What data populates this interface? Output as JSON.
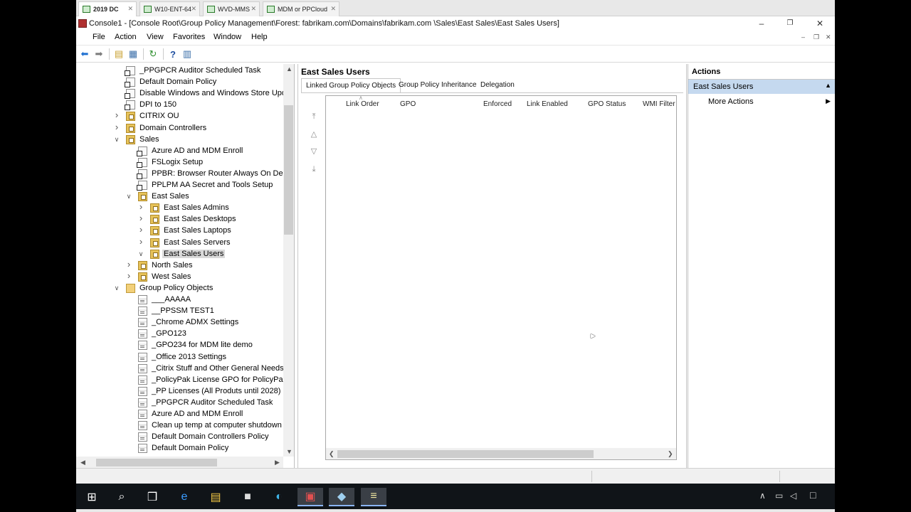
{
  "vm_tabs": [
    {
      "label": "2019 DC",
      "active": true
    },
    {
      "label": "W10-ENT-64",
      "active": false
    },
    {
      "label": "WVD-MMS",
      "active": false
    },
    {
      "label": "MDM or PPCloud",
      "active": false
    }
  ],
  "window": {
    "title": "Console1 - [Console Root\\Group Policy Management\\Forest: fabrikam.com\\Domains\\fabrikam.com \\Sales\\East Sales\\East Sales Users]",
    "minimize": "–",
    "restore": "❐",
    "close": "✕"
  },
  "menu": [
    "File",
    "Action",
    "View",
    "Favorites",
    "Window",
    "Help"
  ],
  "mdi": {
    "minimize": "–",
    "restore": "❐",
    "close": "✕"
  },
  "toolbar": {
    "back_icon": "arrow-left-icon",
    "forward_icon": "arrow-right-icon",
    "up_icon": "folder-up-icon",
    "show_hide_icon": "console-tree-icon",
    "refresh_icon": "refresh-icon",
    "help_icon": "help-icon",
    "action_pane_icon": "action-pane-icon"
  },
  "tree": [
    {
      "label": "_PPGPCR Auditor Scheduled Task",
      "type": "linked",
      "level": 1,
      "exp": ""
    },
    {
      "label": "Default Domain Policy",
      "type": "linked",
      "level": 1,
      "exp": ""
    },
    {
      "label": "Disable Windows and Windows Store Upda",
      "type": "linked",
      "level": 1,
      "exp": ""
    },
    {
      "label": "DPI to 150",
      "type": "linked",
      "level": 1,
      "exp": ""
    },
    {
      "label": "CITRIX OU",
      "type": "ou",
      "level": 1,
      "exp": ">"
    },
    {
      "label": "Domain Controllers",
      "type": "ou",
      "level": 1,
      "exp": ">"
    },
    {
      "label": "Sales",
      "type": "ou",
      "level": 1,
      "exp": "v"
    },
    {
      "label": "Azure AD and MDM Enroll",
      "type": "linked",
      "level": 2,
      "exp": ""
    },
    {
      "label": "FSLogix Setup",
      "type": "linked",
      "level": 2,
      "exp": ""
    },
    {
      "label": "PPBR: Browser Router Always On Demo",
      "type": "linked",
      "level": 2,
      "exp": ""
    },
    {
      "label": "PPLPM AA Secret and Tools Setup",
      "type": "linked",
      "level": 2,
      "exp": ""
    },
    {
      "label": "East Sales",
      "type": "ou",
      "level": 2,
      "exp": "v"
    },
    {
      "label": "East Sales Admins",
      "type": "ou",
      "level": 3,
      "exp": ">"
    },
    {
      "label": "East Sales Desktops",
      "type": "ou",
      "level": 3,
      "exp": ">"
    },
    {
      "label": "East Sales Laptops",
      "type": "ou",
      "level": 3,
      "exp": ">"
    },
    {
      "label": "East Sales Servers",
      "type": "ou",
      "level": 3,
      "exp": ">"
    },
    {
      "label": "East Sales Users",
      "type": "ou",
      "level": 3,
      "exp": "v",
      "selected": true
    },
    {
      "label": "North Sales",
      "type": "ou",
      "level": 2,
      "exp": ">"
    },
    {
      "label": "West Sales",
      "type": "ou",
      "level": 2,
      "exp": ">"
    },
    {
      "label": "Group Policy Objects",
      "type": "folder",
      "level": 1,
      "exp": "v"
    },
    {
      "label": "___AAAAA",
      "type": "gpo",
      "level": 2,
      "exp": ""
    },
    {
      "label": "__PPSSM TEST1",
      "type": "gpo",
      "level": 2,
      "exp": ""
    },
    {
      "label": "_Chrome ADMX Settings",
      "type": "gpo",
      "level": 2,
      "exp": ""
    },
    {
      "label": "_GPO123",
      "type": "gpo",
      "level": 2,
      "exp": ""
    },
    {
      "label": "_GPO234 for MDM lite demo",
      "type": "gpo",
      "level": 2,
      "exp": ""
    },
    {
      "label": "_Office 2013 Settings",
      "type": "gpo",
      "level": 2,
      "exp": ""
    },
    {
      "label": "_Citrix Stuff and Other General Needs",
      "type": "gpo",
      "level": 2,
      "exp": ""
    },
    {
      "label": "_PolicyPak License GPO for PolicyPak C",
      "type": "gpo",
      "level": 2,
      "exp": ""
    },
    {
      "label": "_PP Licenses (All Produts until 2028)",
      "type": "gpo",
      "level": 2,
      "exp": ""
    },
    {
      "label": "_PPGPCR Auditor Scheduled Task",
      "type": "gpo",
      "level": 2,
      "exp": ""
    },
    {
      "label": "Azure AD and MDM Enroll",
      "type": "gpo",
      "level": 2,
      "exp": ""
    },
    {
      "label": "Clean up temp at computer shutdown t",
      "type": "gpo",
      "level": 2,
      "exp": ""
    },
    {
      "label": "Default Domain Controllers Policy",
      "type": "gpo",
      "level": 2,
      "exp": ""
    },
    {
      "label": "Default Domain Policy",
      "type": "gpo",
      "level": 2,
      "exp": ""
    }
  ],
  "center": {
    "title": "East Sales Users",
    "tabs": [
      "Linked Group Policy Objects",
      "Group Policy Inheritance",
      "Delegation"
    ],
    "active_tab": 0,
    "columns": [
      "Link Order",
      "GPO",
      "Enforced",
      "Link Enabled",
      "GPO Status",
      "WMI Filter"
    ],
    "move_buttons": [
      {
        "name": "move-top-icon",
        "glyph": "⤒"
      },
      {
        "name": "move-up-icon",
        "glyph": "△"
      },
      {
        "name": "move-down-icon",
        "glyph": "▽"
      },
      {
        "name": "move-bottom-icon",
        "glyph": "⤓"
      }
    ]
  },
  "actions": {
    "title": "Actions",
    "section": "East Sales Users",
    "items": [
      "More Actions"
    ]
  },
  "taskbar": {
    "apps": [
      {
        "name": "start-icon",
        "glyph": "⊞"
      },
      {
        "name": "search-icon",
        "glyph": "⌕"
      },
      {
        "name": "task-view-icon",
        "glyph": "❒"
      },
      {
        "name": "internet-explorer-icon",
        "glyph": "e"
      },
      {
        "name": "file-explorer-icon",
        "glyph": "▤"
      },
      {
        "name": "command-prompt-icon",
        "glyph": "■"
      },
      {
        "name": "edge-icon",
        "glyph": "◐"
      },
      {
        "name": "mmc-console-icon",
        "glyph": "▣"
      },
      {
        "name": "notepad-app-icon",
        "glyph": "◆"
      },
      {
        "name": "notepad-icon",
        "glyph": "≡"
      }
    ]
  },
  "colors": {
    "selection": "#c5d9ef",
    "taskbar": "#101418",
    "ou": "#e7c35a"
  }
}
